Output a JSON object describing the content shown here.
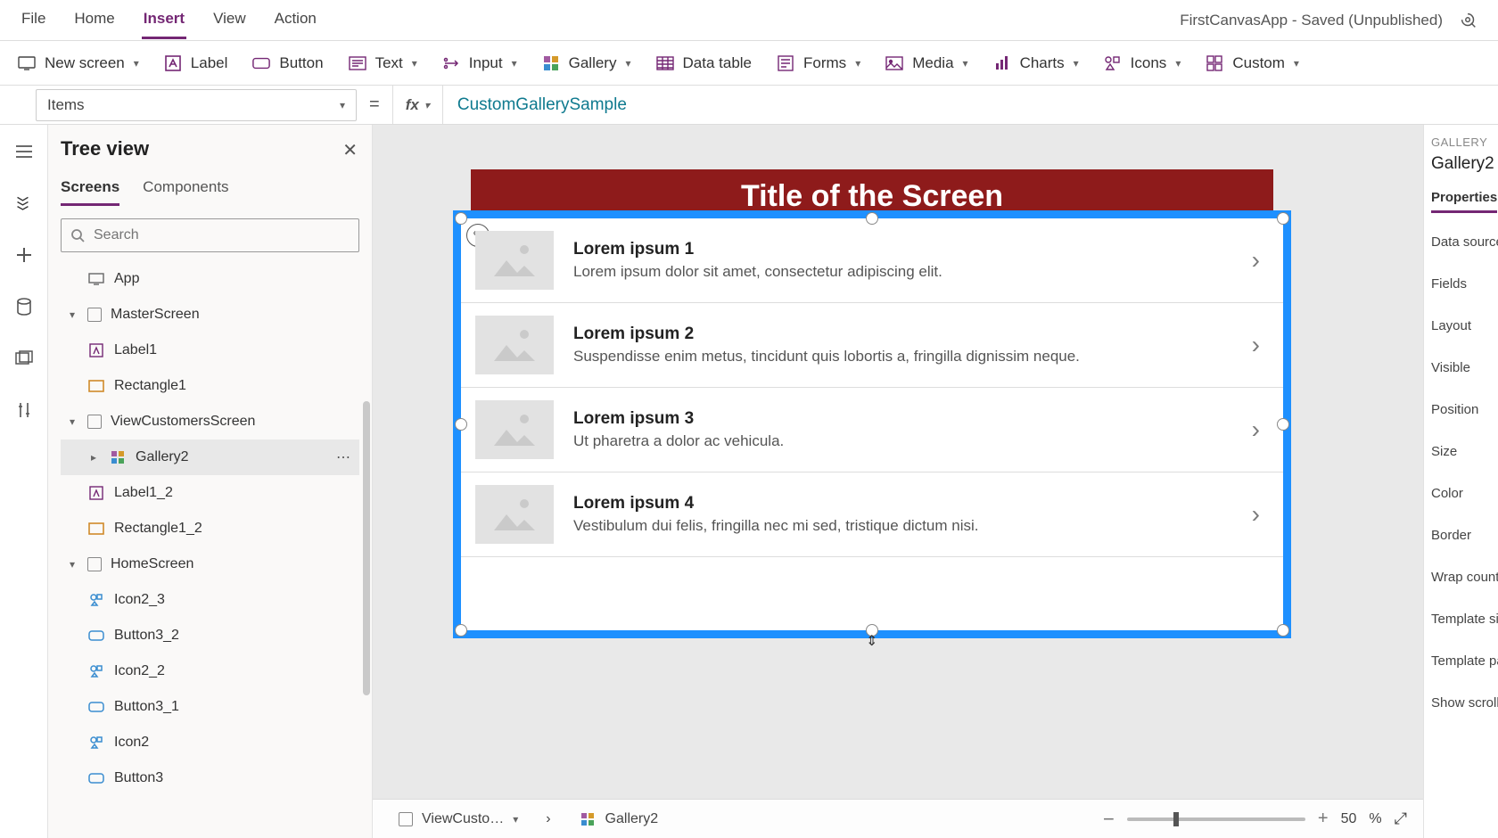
{
  "app": {
    "title": "FirstCanvasApp - Saved (Unpublished)"
  },
  "menu": {
    "file": "File",
    "home": "Home",
    "insert": "Insert",
    "view": "View",
    "action": "Action"
  },
  "ribbon": {
    "new_screen": "New screen",
    "label": "Label",
    "button": "Button",
    "text": "Text",
    "input": "Input",
    "gallery": "Gallery",
    "data_table": "Data table",
    "forms": "Forms",
    "media": "Media",
    "charts": "Charts",
    "icons": "Icons",
    "custom": "Custom"
  },
  "formula": {
    "property": "Items",
    "value": "CustomGallerySample"
  },
  "tree": {
    "title": "Tree view",
    "tabs": {
      "screens": "Screens",
      "components": "Components"
    },
    "search_placeholder": "Search",
    "nodes": {
      "app": "App",
      "master": "MasterScreen",
      "label1": "Label1",
      "rect1": "Rectangle1",
      "viewcust": "ViewCustomersScreen",
      "gallery2": "Gallery2",
      "label1_2": "Label1_2",
      "rect1_2": "Rectangle1_2",
      "home": "HomeScreen",
      "icon2_3": "Icon2_3",
      "button3_2": "Button3_2",
      "icon2_2": "Icon2_2",
      "button3_1": "Button3_1",
      "icon2": "Icon2",
      "button3": "Button3"
    }
  },
  "canvas": {
    "screen_title": "Title of the Screen",
    "items": [
      {
        "title": "Lorem ipsum 1",
        "sub": "Lorem ipsum dolor sit amet, consectetur adipiscing elit."
      },
      {
        "title": "Lorem ipsum 2",
        "sub": "Suspendisse enim metus, tincidunt quis lobortis a, fringilla dignissim neque."
      },
      {
        "title": "Lorem ipsum 3",
        "sub": "Ut pharetra a dolor ac vehicula."
      },
      {
        "title": "Lorem ipsum 4",
        "sub": "Vestibulum dui felis, fringilla nec mi sed, tristique dictum nisi."
      }
    ]
  },
  "statusbar": {
    "crumb1": "ViewCusto…",
    "crumb2": "Gallery2",
    "zoom_value": "50",
    "zoom_pct": "%"
  },
  "props": {
    "header": "GALLERY",
    "name": "Gallery2",
    "tab": "Properties",
    "rows": {
      "datasource": "Data source",
      "fields": "Fields",
      "layout": "Layout",
      "visible": "Visible",
      "position": "Position",
      "size": "Size",
      "color": "Color",
      "border": "Border",
      "wrap": "Wrap count",
      "tsize": "Template siz",
      "tpad": "Template pa",
      "scroll": "Show scrollb"
    }
  }
}
